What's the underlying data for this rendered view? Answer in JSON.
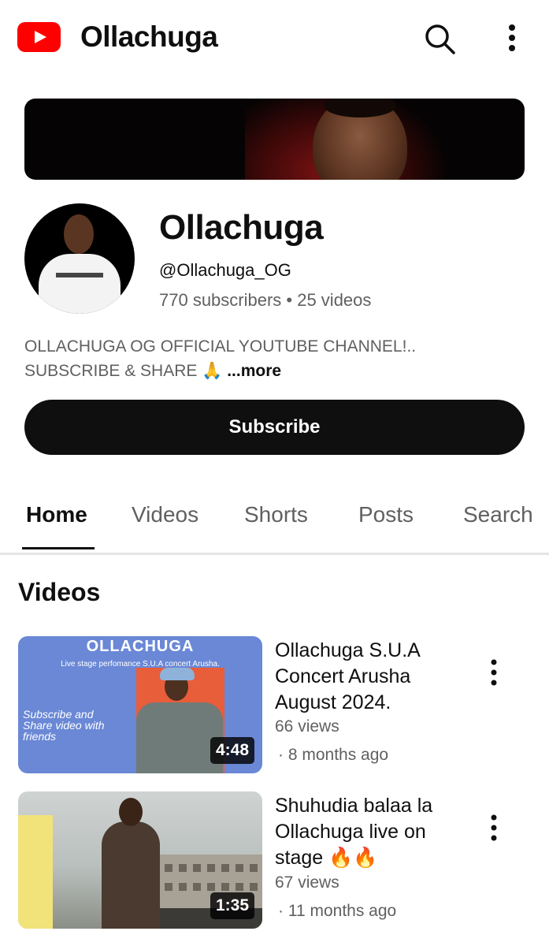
{
  "appbar": {
    "title": "Ollachuga",
    "logo_icon": "youtube-logo-icon",
    "search_icon": "search-icon",
    "more_icon": "more-vert-icon"
  },
  "channel": {
    "name": "Ollachuga",
    "handle": "@Ollachuga_OG",
    "stats": "770 subscribers • 25 videos",
    "description_line1": "OLLACHUGA OG OFFICIAL YOUTUBE CHANNEL!..",
    "description_line2": "SUBSCRIBE & SHARE 🙏",
    "more_label": "...more",
    "subscribe_label": "Subscribe"
  },
  "tabs": [
    {
      "label": "Home",
      "active": true
    },
    {
      "label": "Videos",
      "active": false
    },
    {
      "label": "Shorts",
      "active": false
    },
    {
      "label": "Posts",
      "active": false
    },
    {
      "label": "Search",
      "active": false
    }
  ],
  "section": {
    "title": "Videos"
  },
  "videos": [
    {
      "title": "Ollachuga S.U.A Concert Arusha August 2024.",
      "views": "66 views",
      "age": "· 8 months ago",
      "duration": "4:48",
      "thumb_brand": "OLLACHUGA",
      "thumb_subtitle": "Live stage perfomance S.U.A concert Arusha.",
      "thumb_side_text": "Subscribe and Share video with friends"
    },
    {
      "title": "Shuhudia balaa la Ollachuga live on stage 🔥🔥",
      "views": "67 views",
      "age": "· 11 months ago",
      "duration": "1:35"
    }
  ],
  "colors": {
    "brand_red": "#ff0000",
    "text_primary": "#0f0f0f",
    "text_secondary": "#606060",
    "subscribe_bg": "#0f0f0f"
  }
}
